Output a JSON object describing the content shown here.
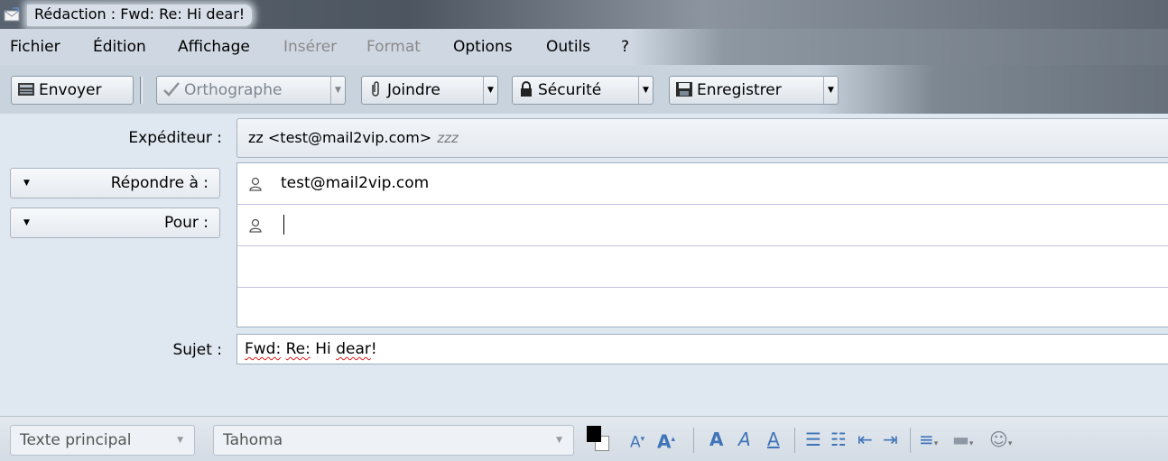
{
  "window": {
    "title": "Rédaction : Fwd: Re: Hi dear!"
  },
  "menu": [
    {
      "label": "Fichier",
      "enabled": true
    },
    {
      "label": "Édition",
      "enabled": true
    },
    {
      "label": "Affichage",
      "enabled": true
    },
    {
      "label": "Insérer",
      "enabled": false
    },
    {
      "label": "Format",
      "enabled": false
    },
    {
      "label": "Options",
      "enabled": true
    },
    {
      "label": "Outils",
      "enabled": true
    },
    {
      "label": "?",
      "enabled": true
    }
  ],
  "toolbar": {
    "send": "Envoyer",
    "spelling": "Orthographe",
    "attach": "Joindre",
    "security": "Sécurité",
    "save": "Enregistrer"
  },
  "headers": {
    "from_label": "Expéditeur :",
    "from_value": "zz <test@mail2vip.com>",
    "from_identity": "zzz",
    "reply_to_label": "Répondre à :",
    "reply_to_value": "test@mail2vip.com",
    "to_label": "Pour :",
    "to_value": "",
    "subject_label": "Sujet :",
    "subject": {
      "fwd": "Fwd:",
      "re": "Re:",
      "hi": "Hi",
      "dear": "dear",
      "bang": "!"
    }
  },
  "format": {
    "paragraph": "Texte principal",
    "font": "Tahoma",
    "text_color": "#000000",
    "bg_color": "#ffffff"
  }
}
